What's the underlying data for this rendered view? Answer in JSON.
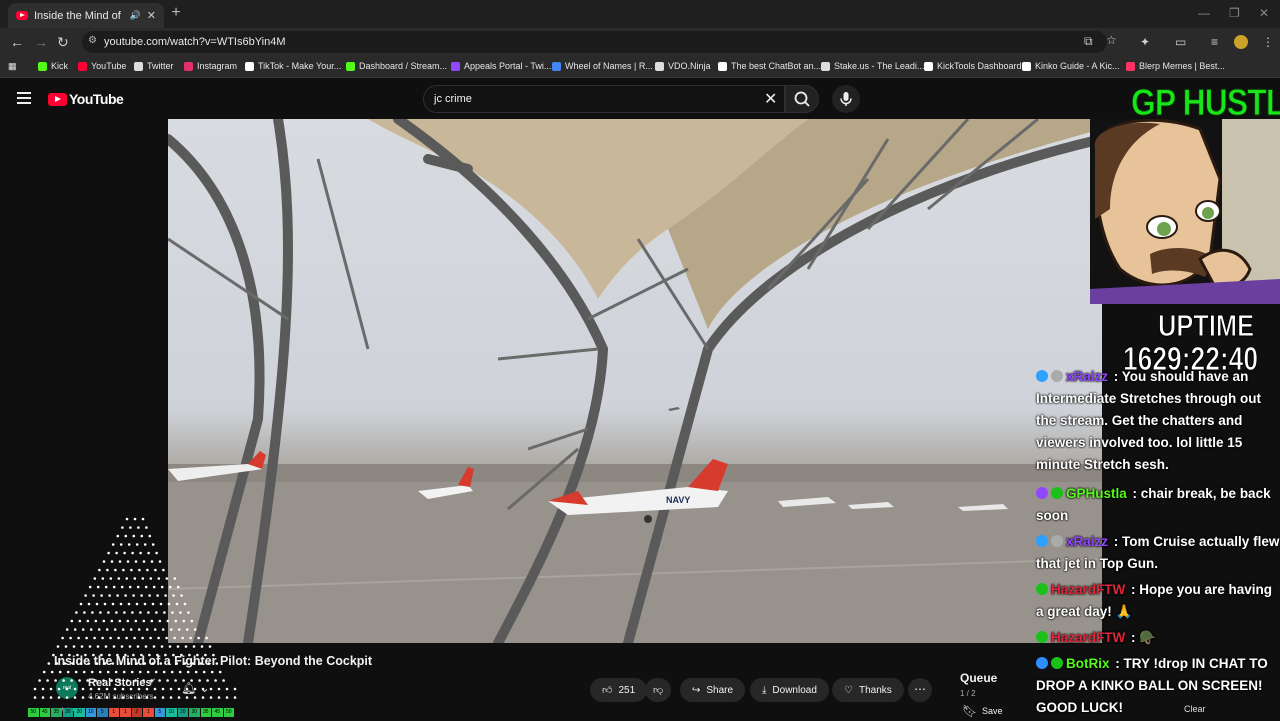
{
  "browser": {
    "tab_title": "Inside the Mind of a Fighter",
    "url": "youtube.com/watch?v=WTIs6bYin4M",
    "bookmarks": [
      {
        "label": "Kick",
        "color": "#53fc18"
      },
      {
        "label": "YouTube",
        "color": "#ff0033"
      },
      {
        "label": "Twitter",
        "color": "#dddddd"
      },
      {
        "label": "Instagram",
        "color": "#e1306c"
      },
      {
        "label": "TikTok - Make Your...",
        "color": "#ffffff"
      },
      {
        "label": "Dashboard / Stream...",
        "color": "#53fc18"
      },
      {
        "label": "Appeals Portal - Twi...",
        "color": "#9146ff"
      },
      {
        "label": "Wheel of Names | R...",
        "color": "#4285f4"
      },
      {
        "label": "VDO.Ninja",
        "color": "#dddddd"
      },
      {
        "label": "The best ChatBot an...",
        "color": "#ffffff"
      },
      {
        "label": "Stake.us - The Leadi...",
        "color": "#dddddd"
      },
      {
        "label": "KickTools Dashboard",
        "color": "#ffffff"
      },
      {
        "label": "Kinko Guide - A Kic...",
        "color": "#ffffff"
      },
      {
        "label": "Blerp Memes | Best...",
        "color": "#ff3366"
      }
    ]
  },
  "youtube": {
    "logo_text": "YouTube",
    "search_value": "jc crime",
    "video_title": "Inside the Mind of a Fighter Pilot: Beyond the Cockpit",
    "channel_name": "Real Stories",
    "channel_subs": "4.62M subscribers",
    "avatar_text": "real stories",
    "likes": "251",
    "share_label": "Share",
    "download_label": "Download",
    "thanks_label": "Thanks",
    "queue_title": "Queue",
    "queue_count": "1 / 2",
    "save_label": "Save",
    "video_plane_text": "NAVY"
  },
  "overlay": {
    "streamer_name": "GP HUSTLA",
    "uptime_label": "UPTIME",
    "uptime_value": "1629:22:40",
    "clear_label": "Clear",
    "bottom_bar": [
      "50",
      "45",
      "35",
      "30",
      "20",
      "10",
      "5",
      "1",
      "1",
      "2",
      "1",
      "5",
      "10",
      "20",
      "30",
      "35",
      "45",
      "50"
    ],
    "chat": [
      {
        "user": "xRaizz",
        "user_color": "#9146ff",
        "text": "You should have an Intermediate Stretches through out the stream. Get the chatters and viewers involved too. lol little 15 minute Stretch sesh.",
        "badge_colors": [
          "#2ea0ff",
          "#aaaaaa"
        ]
      },
      {
        "user": "GPHustla",
        "user_color": "#53fc18",
        "text": "chair break, be back soon",
        "badge_colors": [
          "#9146ff",
          "#19c119"
        ]
      },
      {
        "user": "xRaizz",
        "user_color": "#9146ff",
        "text": "Tom Cruise actually flew that jet in Top Gun.",
        "badge_colors": [
          "#2ea0ff",
          "#aaaaaa"
        ]
      },
      {
        "user": "HazardFTW",
        "user_color": "#e0263a",
        "text": "Hope you are having a great day! 🙏",
        "badge_colors": [
          "#19c119"
        ]
      },
      {
        "user": "HazardFTW",
        "user_color": "#e0263a",
        "text": "🪖",
        "badge_colors": [
          "#19c119"
        ]
      },
      {
        "user": "BotRix",
        "user_color": "#53fc18",
        "text": "TRY !drop IN CHAT TO DROP A KINKO BALL ON SCREEN! GOOD LUCK!",
        "badge_colors": [
          "#2e8dff",
          "#19c119"
        ]
      }
    ]
  }
}
